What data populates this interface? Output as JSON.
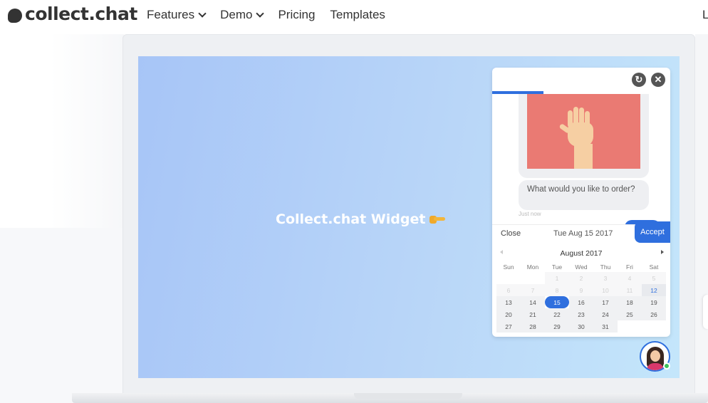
{
  "brand": {
    "name": "collect.chat"
  },
  "nav": {
    "items": [
      {
        "label": "Features",
        "dropdown": true
      },
      {
        "label": "Demo",
        "dropdown": true
      },
      {
        "label": "Pricing",
        "dropdown": false
      },
      {
        "label": "Templates",
        "dropdown": false
      }
    ],
    "right_label": "L"
  },
  "hero": {
    "widget_title": "Collect.chat Widget"
  },
  "chat": {
    "message": "What would you like to order?",
    "time": "Just now",
    "picker": {
      "close_label": "Close",
      "selected_date": "Tue Aug 15 2017",
      "accept_label": "Accept",
      "month_label": "August 2017",
      "weekdays": [
        "Sun",
        "Mon",
        "Tue",
        "Wed",
        "Thu",
        "Fri",
        "Sat"
      ],
      "days": [
        [
          "",
          "",
          "1",
          "2",
          "3",
          "4",
          "5"
        ],
        [
          "6",
          "7",
          "8",
          "9",
          "10",
          "11",
          "12"
        ],
        [
          "13",
          "14",
          "15",
          "16",
          "17",
          "18",
          "19"
        ],
        [
          "20",
          "21",
          "22",
          "23",
          "24",
          "25",
          "26"
        ],
        [
          "27",
          "28",
          "29",
          "30",
          "31",
          "",
          ""
        ]
      ],
      "disabled_through": 11,
      "today": 12,
      "selected": 15
    }
  },
  "colors": {
    "accent": "#2f6fde",
    "image_bg": "#ea7a73",
    "online": "#3cc15d"
  }
}
